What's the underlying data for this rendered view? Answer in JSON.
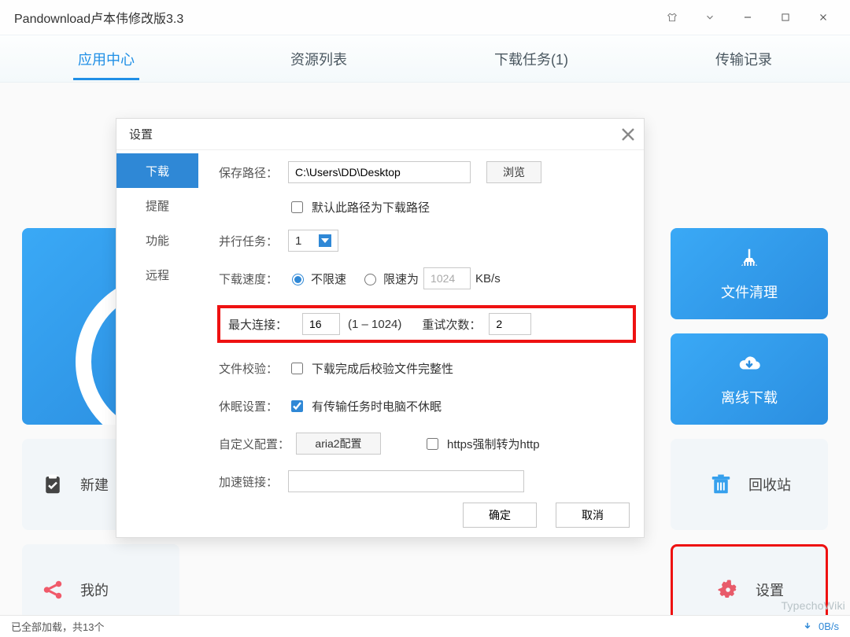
{
  "window": {
    "title": "Pandownload卢本伟修改版3.3"
  },
  "tabs": [
    {
      "label": "应用中心",
      "active": true
    },
    {
      "label": "资源列表",
      "active": false
    },
    {
      "label": "下载任务(1)",
      "active": false
    },
    {
      "label": "传输记录",
      "active": false
    }
  ],
  "rightTiles": {
    "clean": "文件清理",
    "offline": "离线下载",
    "recycle": "回收站",
    "settings": "设置"
  },
  "leftTiles": {
    "newTask": "新建",
    "mine": "我的"
  },
  "dialog": {
    "title": "设置",
    "side": [
      "下载",
      "提醒",
      "功能",
      "远程"
    ],
    "activeSide": 0,
    "savePathLabel": "保存路径：",
    "savePath": "C:\\Users\\DD\\Desktop",
    "browse": "浏览",
    "defaultPath": "默认此路径为下载路径",
    "parallelLabel": "并行任务：",
    "parallelValue": "1",
    "speedLabel": "下载速度：",
    "speedUnlimited": "不限速",
    "speedLimited": "限速为",
    "speedLimitValue": "1024",
    "speedUnit": "KB/s",
    "maxConnLabel": "最大连接：",
    "maxConn": "16",
    "maxConnRange": "(1 – 1024)",
    "retryLabel": "重试次数：",
    "retry": "2",
    "fileVerifyLabel": "文件校验：",
    "fileVerify": "下载完成后校验文件完整性",
    "sleepLabel": "休眠设置：",
    "sleepText": "有传输任务时电脑不休眠",
    "customCfgLabel": "自定义配置：",
    "aria2": "aria2配置",
    "httpsForce": "https强制转为http",
    "accelLabel": "加速链接：",
    "ok": "确定",
    "cancel": "取消"
  },
  "statusbar": {
    "text": "已全部加载，共13个",
    "speed": "0B/s"
  },
  "watermark": "TypechoWiki"
}
